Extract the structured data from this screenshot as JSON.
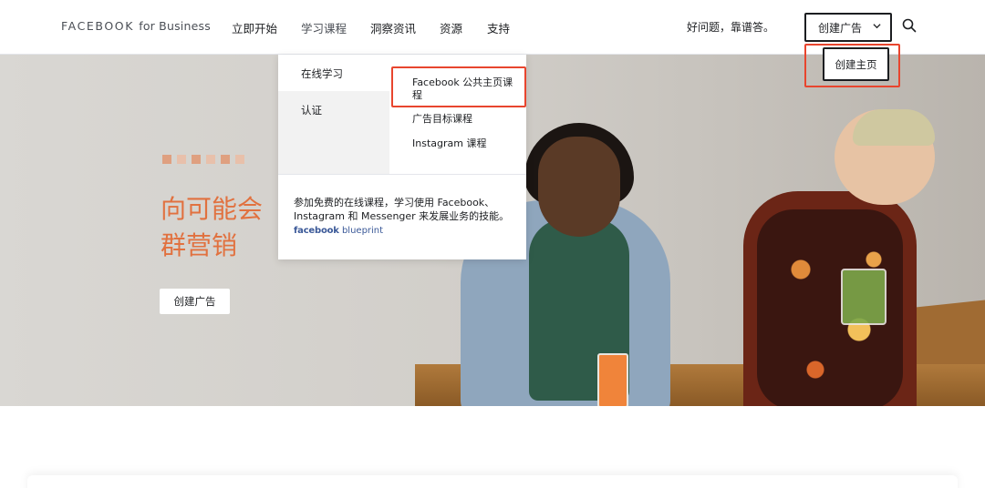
{
  "header": {
    "brand_main": "FACEBOOK",
    "brand_sub": "for Business",
    "nav": [
      "立即开始",
      "学习课程",
      "洞察资讯",
      "资源",
      "支持"
    ],
    "faq": "好问题，靠谱答。",
    "create_ad": "创建广告"
  },
  "dropdown": {
    "categories": [
      "在线学习",
      "认证"
    ],
    "subitems": [
      "Facebook 公共主页课程",
      "广告目标课程",
      "Instagram 课程"
    ],
    "description": "参加免费的在线课程，学习使用 Facebook、Instagram 和 Messenger 来发展业务的技能。",
    "logo_bold": "facebook",
    "logo_light": "blueprint"
  },
  "create_page_popup": "创建主页",
  "hero": {
    "headline_line1": "向可能会",
    "headline_line2": "群营销",
    "cta": "创建广告"
  },
  "colors": {
    "accent_orange": "#e1713f",
    "highlight_red": "#e8452e",
    "facebook_blue": "#3b5998"
  }
}
